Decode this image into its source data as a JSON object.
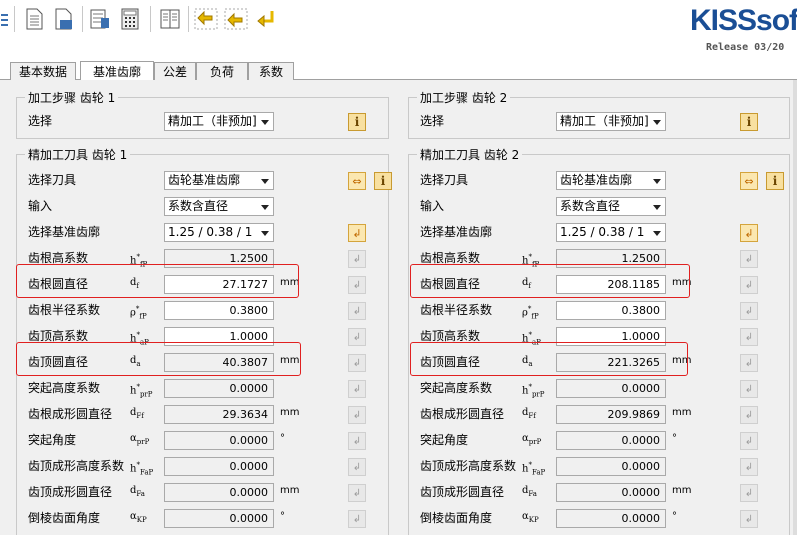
{
  "app": {
    "brand": "KISSsof",
    "release": "Release 03/20"
  },
  "toolbar": {
    "icons": [
      "new-document-icon",
      "open-icon",
      "save-icon",
      "database-icon",
      "calculator-icon",
      "report-icon",
      "gear-pair-icon",
      "gear-pair-yellow-icon",
      "gear-return-icon"
    ]
  },
  "tabs": [
    {
      "label": "基本数据",
      "active": false
    },
    {
      "label": "基准齿廓",
      "active": true
    },
    {
      "label": "公差",
      "active": false
    },
    {
      "label": "负荷",
      "active": false
    },
    {
      "label": "系数",
      "active": false
    }
  ],
  "gears": [
    {
      "process_title": "加工步骤 齿轮 1",
      "select_label": "选择",
      "select_value": "精加工（非预加]",
      "tool_title": "精加工刀具 齿轮 1",
      "rows": [
        {
          "label": "选择刀具",
          "kind": "combo",
          "value": "齿轮基准齿廓",
          "btn": "arrow-info"
        },
        {
          "label": "输入",
          "kind": "combo",
          "value": "系数含直径"
        },
        {
          "label": "选择基准齿廓",
          "kind": "combo",
          "value": "1.25 / 0.38 / 1",
          "btn": "arrow"
        },
        {
          "label": "齿根高系数",
          "sym": "h*fP",
          "value": "1.2500",
          "unit": "",
          "edit": false
        },
        {
          "label": "齿根圆直径",
          "sym": "df",
          "value": "27.1727",
          "unit": "mm",
          "edit": true
        },
        {
          "label": "齿根半径系数",
          "sym": "ρ*fP",
          "value": "0.3800",
          "unit": "",
          "edit": true
        },
        {
          "label": "齿顶高系数",
          "sym": "h*aP",
          "value": "1.0000",
          "unit": "",
          "edit": true
        },
        {
          "label": "齿顶圆直径",
          "sym": "da",
          "value": "40.3807",
          "unit": "mm",
          "edit": false
        },
        {
          "label": "突起高度系数",
          "sym": "h*prP",
          "value": "0.0000",
          "unit": "",
          "edit": false
        },
        {
          "label": "齿根成形圆直径",
          "sym": "dFf",
          "value": "29.3634",
          "unit": "mm",
          "edit": false
        },
        {
          "label": "突起角度",
          "sym": "αprP",
          "value": "0.0000",
          "unit": "°",
          "edit": false
        },
        {
          "label": "齿顶成形高度系数",
          "sym": "h*FaP",
          "value": "0.0000",
          "unit": "",
          "edit": false
        },
        {
          "label": "齿顶成形圆直径",
          "sym": "dFa",
          "value": "0.0000",
          "unit": "mm",
          "edit": false
        },
        {
          "label": "倒棱齿面角度",
          "sym": "αKP",
          "value": "0.0000",
          "unit": "°",
          "edit": false
        }
      ]
    },
    {
      "process_title": "加工步骤 齿轮 2",
      "select_label": "选择",
      "select_value": "精加工（非预加]",
      "tool_title": "精加工刀具 齿轮 2",
      "rows": [
        {
          "label": "选择刀具",
          "kind": "combo",
          "value": "齿轮基准齿廓",
          "btn": "arrow-info"
        },
        {
          "label": "输入",
          "kind": "combo",
          "value": "系数含直径"
        },
        {
          "label": "选择基准齿廓",
          "kind": "combo",
          "value": "1.25 / 0.38 / 1",
          "btn": "arrow"
        },
        {
          "label": "齿根高系数",
          "sym": "h*fP",
          "value": "1.2500",
          "unit": "",
          "edit": false
        },
        {
          "label": "齿根圆直径",
          "sym": "df",
          "value": "208.1185",
          "unit": "mm",
          "edit": true
        },
        {
          "label": "齿根半径系数",
          "sym": "ρ*fP",
          "value": "0.3800",
          "unit": "",
          "edit": true
        },
        {
          "label": "齿顶高系数",
          "sym": "h*aP",
          "value": "1.0000",
          "unit": "",
          "edit": true
        },
        {
          "label": "齿顶圆直径",
          "sym": "da",
          "value": "221.3265",
          "unit": "mm",
          "edit": false
        },
        {
          "label": "突起高度系数",
          "sym": "h*prP",
          "value": "0.0000",
          "unit": "",
          "edit": false
        },
        {
          "label": "齿根成形圆直径",
          "sym": "dFf",
          "value": "209.9869",
          "unit": "mm",
          "edit": false
        },
        {
          "label": "突起角度",
          "sym": "αprP",
          "value": "0.0000",
          "unit": "°",
          "edit": false
        },
        {
          "label": "齿顶成形高度系数",
          "sym": "h*FaP",
          "value": "0.0000",
          "unit": "",
          "edit": false
        },
        {
          "label": "齿顶成形圆直径",
          "sym": "dFa",
          "value": "0.0000",
          "unit": "mm",
          "edit": false
        },
        {
          "label": "倒棱齿面角度",
          "sym": "αKP",
          "value": "0.0000",
          "unit": "°",
          "edit": false
        }
      ]
    }
  ],
  "highlight_color": "#e02020"
}
